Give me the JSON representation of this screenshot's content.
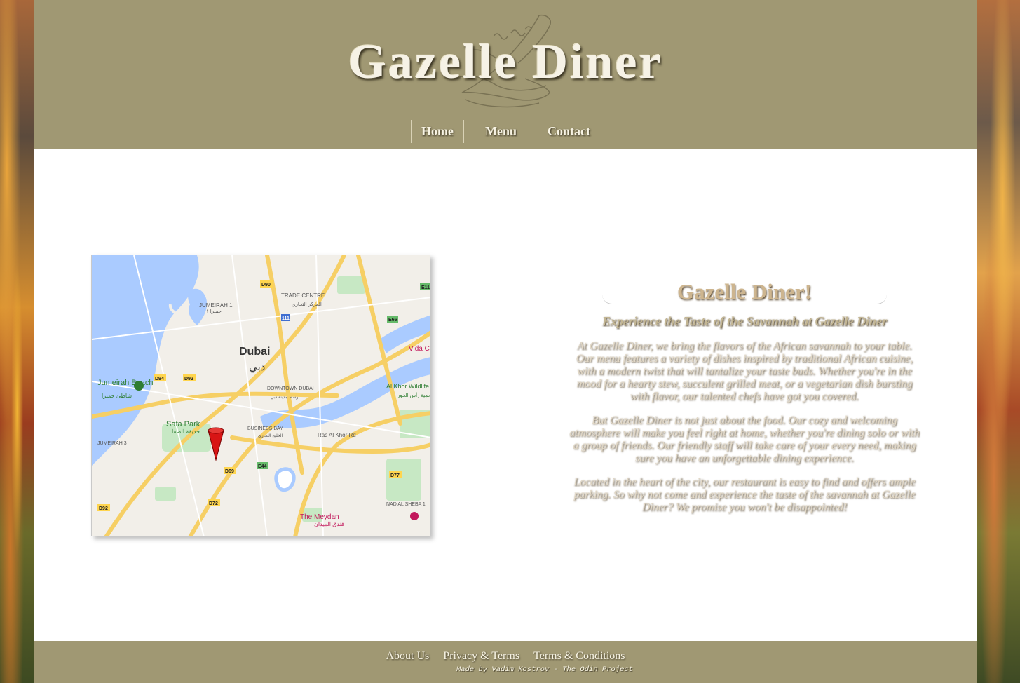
{
  "brand": {
    "name": "Gazelle Diner"
  },
  "nav": {
    "items": [
      {
        "label": "Home",
        "active": true
      },
      {
        "label": "Menu",
        "active": false
      },
      {
        "label": "Contact",
        "active": false
      }
    ]
  },
  "map": {
    "labels": {
      "city_en": "Dubai",
      "city_ar": "دبي",
      "jumeirah1": "JUMEIRAH 1",
      "jumeirah1_ar": "جميرا ١",
      "trade_centre": "TRADE CENTRE",
      "trade_centre_ar": "المركز التجاري",
      "jumeirah_beach": "Jumeirah Beach",
      "jumeirah_beach_ar": "شاطئ جميرا",
      "downtown": "DOWNTOWN DUBAI",
      "downtown_ar": "وسط مدينة دبي",
      "safa_park": "Safa Park",
      "safa_park_ar": "حديقة الصفا",
      "business_bay": "BUSINESS BAY",
      "business_bay_ar": "الخليج التجاري",
      "ras_al_khor": "Ras Al Khor Rd",
      "jumeirah3": "JUMEIRAH 3",
      "meydan": "The Meydan",
      "meydan_ar": "فندق الميدان",
      "nad_al_sheba": "NAD AL SHEBA 1",
      "wildlife": "Al Khor Wildlife Sanc",
      "wildlife_ar": "محمية رأس الخور",
      "vida": "Vida C",
      "road_d90": "D90",
      "road_d94": "D94",
      "road_d92": "D92",
      "road_d92b": "D92",
      "road_e11": "E11",
      "road_e66": "E66",
      "road_e44": "E44",
      "road_d69": "D69",
      "road_d72": "D72",
      "road_d77": "D77",
      "road_e11b": "E11",
      "road_111": "111"
    }
  },
  "content": {
    "title": "Gazelle Diner!",
    "subtitle": "Experience the Taste of the Savannah at Gazelle Diner",
    "paragraphs": [
      "At Gazelle Diner, we bring the flavors of the African savannah to your table. Our menu features a variety of dishes inspired by traditional African cuisine, with a modern twist that will tantalize your taste buds. Whether you're in the mood for a hearty stew, succulent grilled meat, or a vegetarian dish bursting with flavor, our talented chefs have got you covered.",
      "But Gazelle Diner is not just about the food. Our cozy and welcoming atmosphere will make you feel right at home, whether you're dining solo or with a group of friends. Our friendly staff will take care of your every need, making sure you have an unforgettable dining experience.",
      "Located in the heart of the city, our restaurant is easy to find and offers ample parking. So why not come and experience the taste of the savannah at Gazelle Diner? We promise you won't be disappointed!"
    ]
  },
  "footer": {
    "links": [
      "About Us",
      "Privacy & Terms",
      "Terms & Conditions"
    ],
    "credit": "Made by Vadim Kostrov - The Odin Project"
  },
  "colors": {
    "header_bg": "#a09873",
    "nav_text": "#f8f4e4",
    "title_text": "#cdb58f"
  }
}
